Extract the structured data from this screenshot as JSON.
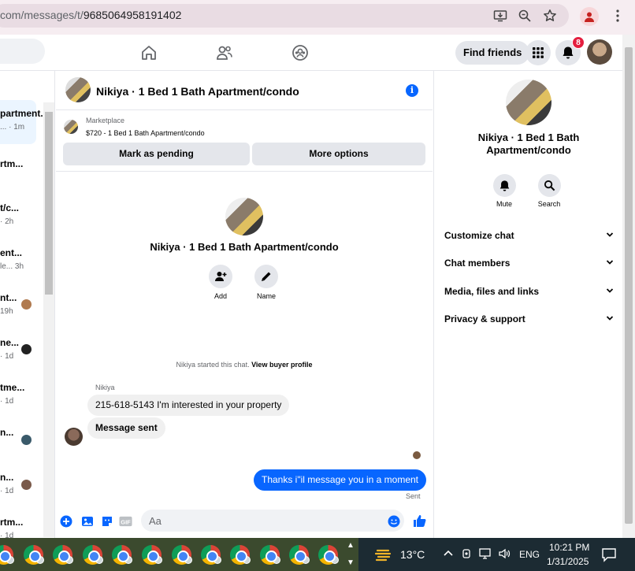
{
  "browser": {
    "url_prefix": "com/messages/t/",
    "url_id": "9685064958191402"
  },
  "header": {
    "find_friends_label": "Find friends",
    "notification_count": "8"
  },
  "conversations": [
    {
      "title": "partment...",
      "sub": "... · 1m"
    },
    {
      "title": "rtm...",
      "sub": ""
    },
    {
      "title": "t/c...",
      "sub": "· 2h"
    },
    {
      "title": "ent...",
      "sub": "le... 3h"
    },
    {
      "title": "nt...",
      "sub": "19h"
    },
    {
      "title": "ne...",
      "sub": "· 1d"
    },
    {
      "title": "tme...",
      "sub": "· 1d"
    },
    {
      "title": "n...",
      "sub": ""
    },
    {
      "title": "n...",
      "sub": "· 1d"
    },
    {
      "title": "rtm...",
      "sub": "· 1d"
    }
  ],
  "chat": {
    "title": "Nikiya · 1 Bed 1 Bath Apartment/condo",
    "marketplace_label": "Marketplace",
    "listing": "$720 - 1 Bed 1 Bath Apartment/condo",
    "mark_pending_label": "Mark as pending",
    "more_options_label": "More options",
    "add_label": "Add",
    "name_label": "Name",
    "started_text": "Nikiya started this chat.",
    "view_profile_label": "View buyer profile",
    "sender_name": "Nikiya",
    "messages_in": [
      "215-618-5143 I'm interested in your property",
      "Message sent"
    ],
    "message_out": "Thanks i\"il message you in a moment",
    "sent_label": "Sent",
    "composer_placeholder": "Aa"
  },
  "details": {
    "title": "Nikiya · 1 Bed 1 Bath Apartment/condo",
    "mute_label": "Mute",
    "search_label": "Search",
    "sections": [
      "Customize chat",
      "Chat members",
      "Media, files and links",
      "Privacy & support"
    ]
  },
  "taskbar": {
    "temperature": "13°C",
    "language": "ENG",
    "time": "10:21 PM",
    "date": "1/31/2025"
  },
  "colors": {
    "accent": "#0866ff",
    "badge": "#e41e3f"
  }
}
